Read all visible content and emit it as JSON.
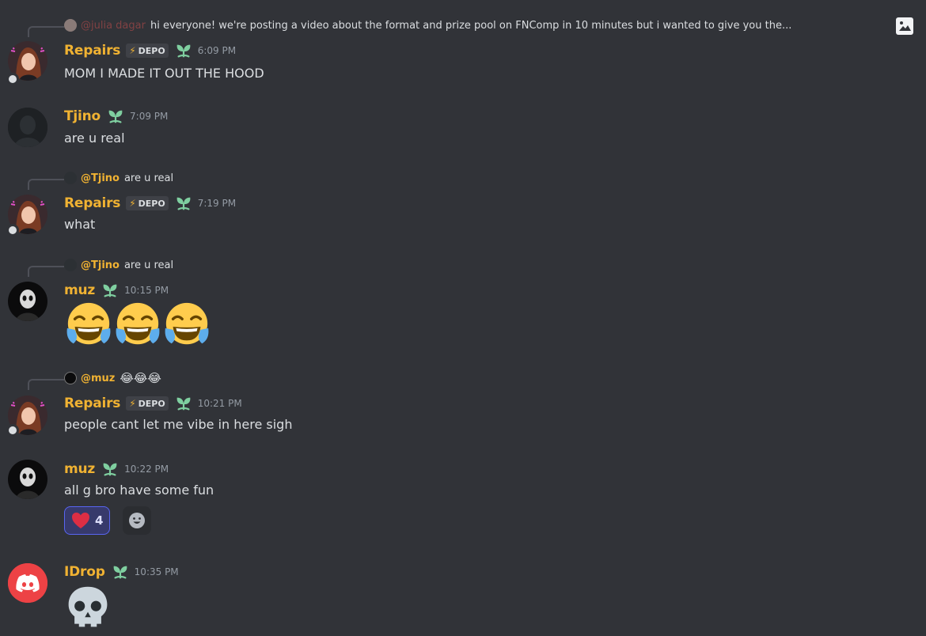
{
  "colors": {
    "background": "#313338",
    "username": "#f0b232",
    "text": "#dbdee1",
    "timestamp": "#949ba4",
    "reaction_bg": "#373a6b",
    "reaction_border": "#5865f2",
    "discord_red": "#ed4245"
  },
  "top_reply": {
    "author": "@julia dagar",
    "text": "hi everyone! we're posting a video about the format and prize pool on FNComp in 10 minutes  but i wanted to give you the..."
  },
  "messages": [
    {
      "author": "Repairs",
      "tag": "DEPO",
      "time": "6:09 PM",
      "text": "MOM I MADE IT OUT THE HOOD"
    },
    {
      "author": "Tjino",
      "time": "7:09 PM",
      "text": "are u real"
    },
    {
      "reply_author": "@Tjino",
      "reply_text": "are u real",
      "author": "Repairs",
      "tag": "DEPO",
      "time": "7:19 PM",
      "text": "what"
    },
    {
      "reply_author": "@Tjino",
      "reply_text": "are u real",
      "author": "muz",
      "time": "10:15 PM",
      "emoji": [
        "laughing-crying",
        "laughing-crying",
        "laughing-crying"
      ]
    },
    {
      "reply_author": "@muz",
      "reply_text": "😂😂😂",
      "author": "Repairs",
      "tag": "DEPO",
      "time": "10:21 PM",
      "text": "people cant let me vibe in here sigh"
    },
    {
      "author": "muz",
      "time": "10:22 PM",
      "text": "all g bro have some fun",
      "reaction": {
        "emoji": "heart",
        "count": "4"
      }
    },
    {
      "author": "IDrop",
      "time": "10:35 PM",
      "emoji": [
        "skull"
      ]
    }
  ]
}
